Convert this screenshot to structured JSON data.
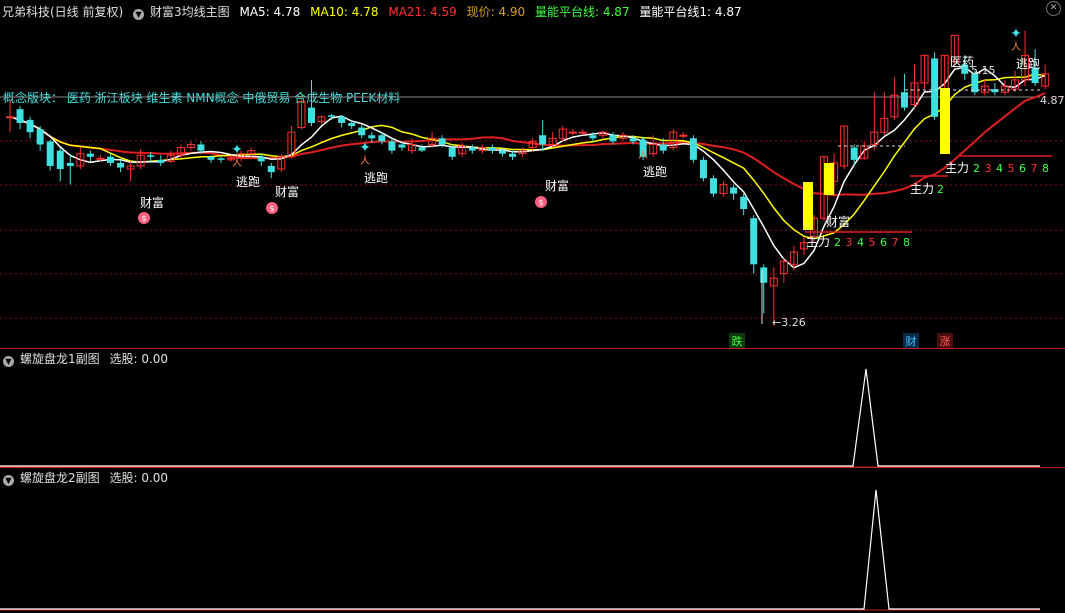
{
  "main_header": {
    "stock": "兄弟科技(日线 前复权)",
    "indicator": "财富3均线主图",
    "ma5": "MA5: 4.78",
    "ma10": "MA10: 4.78",
    "ma21": "MA21: 4.59",
    "price": "现价: 4.90",
    "platform": "量能平台线: 4.87",
    "platform1": "量能平台线1: 4.87"
  },
  "concept_text": "概念版块：  医药 浙江板块 维生素 NMN概念 中俄贸易 合成生物 PEEK材料",
  "chart_labels": {
    "wealth": "财富",
    "escape": "逃跑",
    "medicine": "医药",
    "main_force": "主力",
    "low_price": "3.26",
    "high_price": "5.15",
    "current_price": "4.87",
    "die": "跌",
    "cai": "财",
    "zhang": "涨",
    "numbers": [
      "2",
      "3",
      "4",
      "5",
      "6",
      "7",
      "8"
    ]
  },
  "sub1_header": {
    "name": "螺旋盘龙1副图",
    "value": "选股: 0.00"
  },
  "sub2_header": {
    "name": "螺旋盘龙2副图",
    "value": "选股: 0.00"
  },
  "colors": {
    "up": "#ff3030",
    "down": "#40e0e0",
    "ma5": "#ffffff",
    "ma10": "#ffff00",
    "ma21": "#e02020",
    "grid": "#8a1010",
    "concept": "#40e0e0",
    "green": "#40ff40",
    "yellow": "#ffff00"
  },
  "chart_data": {
    "type": "candlestick",
    "price_range": [
      3.2,
      5.25
    ],
    "candles": [
      [
        4.62,
        4.62,
        4.73,
        4.52
      ],
      [
        4.67,
        4.58,
        4.69,
        4.54
      ],
      [
        4.6,
        4.52,
        4.62,
        4.48
      ],
      [
        4.54,
        4.44,
        4.56,
        4.4
      ],
      [
        4.46,
        4.3,
        4.47,
        4.27
      ],
      [
        4.4,
        4.28,
        4.42,
        4.2
      ],
      [
        4.32,
        4.3,
        4.38,
        4.18
      ],
      [
        4.3,
        4.38,
        4.42,
        4.28
      ],
      [
        4.38,
        4.36,
        4.4,
        4.33
      ],
      [
        4.35,
        4.35,
        4.37,
        4.33
      ],
      [
        4.36,
        4.32,
        4.38,
        4.3
      ],
      [
        4.32,
        4.29,
        4.34,
        4.26
      ],
      [
        4.28,
        4.3,
        4.33,
        4.2
      ],
      [
        4.3,
        4.37,
        4.41,
        4.28
      ],
      [
        4.37,
        4.36,
        4.39,
        4.32
      ],
      [
        4.34,
        4.32,
        4.37,
        4.3
      ],
      [
        4.33,
        4.37,
        4.4,
        4.32
      ],
      [
        4.37,
        4.42,
        4.44,
        4.35
      ],
      [
        4.42,
        4.44,
        4.46,
        4.4
      ],
      [
        4.44,
        4.4,
        4.46,
        4.38
      ],
      [
        4.36,
        4.34,
        4.37,
        4.32
      ],
      [
        4.35,
        4.34,
        4.37,
        4.32
      ],
      [
        4.34,
        4.35,
        4.37,
        4.33
      ],
      [
        4.35,
        4.38,
        4.4,
        4.33
      ],
      [
        4.38,
        4.4,
        4.42,
        4.36
      ],
      [
        4.36,
        4.33,
        4.38,
        4.3
      ],
      [
        4.3,
        4.26,
        4.32,
        4.22
      ],
      [
        4.28,
        4.36,
        4.38,
        4.26
      ],
      [
        4.36,
        4.52,
        4.56,
        4.35
      ],
      [
        4.55,
        4.72,
        4.78,
        4.54
      ],
      [
        4.68,
        4.58,
        4.86,
        4.56
      ],
      [
        4.59,
        4.62,
        4.63,
        4.57
      ],
      [
        4.63,
        4.62,
        4.64,
        4.6
      ],
      [
        4.62,
        4.58,
        4.63,
        4.55
      ],
      [
        4.58,
        4.56,
        4.6,
        4.54
      ],
      [
        4.55,
        4.5,
        4.57,
        4.48
      ],
      [
        4.5,
        4.48,
        4.52,
        4.45
      ],
      [
        4.5,
        4.46,
        4.52,
        4.44
      ],
      [
        4.46,
        4.4,
        4.48,
        4.38
      ],
      [
        4.44,
        4.42,
        4.46,
        4.4
      ],
      [
        4.4,
        4.44,
        4.48,
        4.38
      ],
      [
        4.42,
        4.4,
        4.44,
        4.39
      ],
      [
        4.44,
        4.48,
        4.52,
        4.42
      ],
      [
        4.48,
        4.44,
        4.5,
        4.42
      ],
      [
        4.42,
        4.36,
        4.44,
        4.34
      ],
      [
        4.38,
        4.43,
        4.45,
        4.36
      ],
      [
        4.42,
        4.4,
        4.44,
        4.38
      ],
      [
        4.4,
        4.42,
        4.44,
        4.38
      ],
      [
        4.42,
        4.4,
        4.44,
        4.38
      ],
      [
        4.4,
        4.38,
        4.42,
        4.36
      ],
      [
        4.38,
        4.36,
        4.4,
        4.34
      ],
      [
        4.38,
        4.4,
        4.42,
        4.36
      ],
      [
        4.42,
        4.46,
        4.48,
        4.4
      ],
      [
        4.5,
        4.44,
        4.6,
        4.4
      ],
      [
        4.44,
        4.48,
        4.52,
        4.42
      ],
      [
        4.48,
        4.54,
        4.56,
        4.46
      ],
      [
        4.52,
        4.52,
        4.54,
        4.5
      ],
      [
        4.52,
        4.52,
        4.54,
        4.5
      ],
      [
        4.5,
        4.48,
        4.52,
        4.46
      ],
      [
        4.5,
        4.52,
        4.53,
        4.48
      ],
      [
        4.5,
        4.46,
        4.52,
        4.44
      ],
      [
        4.48,
        4.5,
        4.52,
        4.46
      ],
      [
        4.48,
        4.46,
        4.5,
        4.44
      ],
      [
        4.46,
        4.36,
        4.48,
        4.34
      ],
      [
        4.38,
        4.44,
        4.5,
        4.36
      ],
      [
        4.44,
        4.4,
        4.48,
        4.38
      ],
      [
        4.42,
        4.52,
        4.54,
        4.4
      ],
      [
        4.5,
        4.5,
        4.52,
        4.48
      ],
      [
        4.48,
        4.34,
        4.5,
        4.32
      ],
      [
        4.34,
        4.22,
        4.36,
        4.2
      ],
      [
        4.22,
        4.12,
        4.24,
        4.1
      ],
      [
        4.12,
        4.18,
        4.2,
        4.1
      ],
      [
        4.16,
        4.12,
        4.18,
        4.08
      ],
      [
        4.1,
        4.02,
        4.12,
        3.98
      ],
      [
        3.96,
        3.66,
        3.98,
        3.6
      ],
      [
        3.64,
        3.54,
        3.66,
        3.34
      ],
      [
        3.52,
        3.57,
        3.64,
        3.26
      ],
      [
        3.6,
        3.68,
        3.7,
        3.54
      ],
      [
        3.66,
        3.74,
        3.78,
        3.62
      ],
      [
        3.76,
        3.8,
        3.84,
        3.72
      ],
      [
        3.84,
        3.96,
        3.98,
        3.8
      ],
      [
        3.96,
        4.36,
        4.36,
        3.94
      ],
      [
        4.2,
        4.32,
        4.38,
        4.1
      ],
      [
        4.3,
        4.56,
        4.56,
        4.28
      ],
      [
        4.42,
        4.34,
        4.44,
        4.3
      ],
      [
        4.35,
        4.43,
        4.46,
        4.34
      ],
      [
        4.44,
        4.52,
        4.78,
        4.4
      ],
      [
        4.52,
        4.61,
        4.78,
        4.5
      ],
      [
        4.62,
        4.76,
        4.88,
        4.6
      ],
      [
        4.78,
        4.68,
        4.9,
        4.66
      ],
      [
        4.7,
        4.84,
        4.96,
        4.68
      ],
      [
        4.84,
        5.02,
        5.02,
        4.8
      ],
      [
        5.0,
        4.62,
        5.04,
        4.6
      ],
      [
        4.66,
        5.02,
        5.02,
        4.64
      ],
      [
        4.98,
        5.15,
        5.15,
        4.94
      ],
      [
        4.96,
        4.9,
        5.02,
        4.86
      ],
      [
        4.9,
        4.78,
        4.92,
        4.76
      ],
      [
        4.78,
        4.82,
        4.86,
        4.76
      ],
      [
        4.8,
        4.78,
        4.84,
        4.76
      ],
      [
        4.78,
        4.82,
        4.86,
        4.76
      ],
      [
        4.8,
        4.86,
        4.92,
        4.78
      ],
      [
        4.86,
        5.02,
        5.18,
        4.82
      ],
      [
        4.94,
        4.84,
        5.06,
        4.82
      ],
      [
        4.82,
        4.9,
        4.96,
        4.8
      ]
    ],
    "annotations": [
      "财富",
      "逃跑",
      "医药",
      "主力",
      "3.26",
      "5.15",
      "4.87"
    ]
  }
}
